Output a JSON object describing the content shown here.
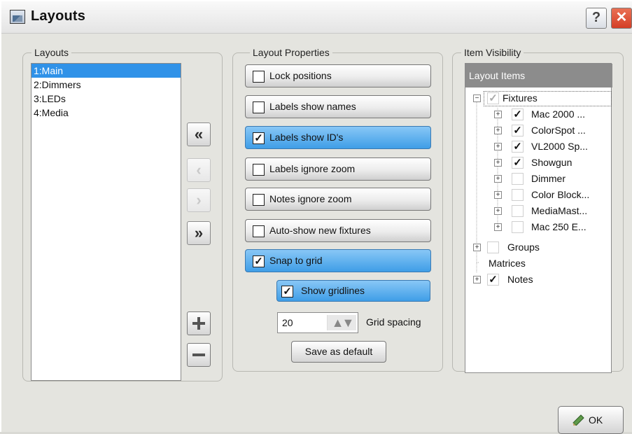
{
  "window": {
    "title": "Layouts",
    "help_label": "?",
    "close_label": "✕"
  },
  "layouts": {
    "group_label": "Layouts",
    "items": [
      "1:Main",
      "2:Dimmers",
      "3:LEDs",
      "4:Media"
    ],
    "selected_index": 0
  },
  "buttons": {
    "move_first": "«",
    "move_prev": "‹",
    "move_next": "›",
    "move_last": "»"
  },
  "properties": {
    "group_label": "Layout Properties",
    "items": [
      {
        "label": "Lock positions",
        "checked": false
      },
      {
        "label": "Labels show names",
        "checked": false
      },
      {
        "label": "Labels show ID's",
        "checked": true
      },
      {
        "label": "Labels ignore zoom",
        "checked": false
      },
      {
        "label": "Notes ignore zoom",
        "checked": false
      },
      {
        "label": "Auto-show new fixtures",
        "checked": false
      },
      {
        "label": "Snap to grid",
        "checked": true
      }
    ],
    "show_gridlines": {
      "label": "Show gridlines",
      "checked": true
    },
    "grid_spacing_value": "20",
    "grid_spacing_label": "Grid spacing",
    "save_default_label": "Save as default"
  },
  "visibility": {
    "group_label": "Item Visibility",
    "header": "Layout Items",
    "fixtures": {
      "label": "Fixtures",
      "checked": true,
      "expander": "−"
    },
    "fixture_items": [
      {
        "label": "Mac 2000 ...",
        "checked": true
      },
      {
        "label": "ColorSpot ...",
        "checked": true
      },
      {
        "label": "VL2000 Sp...",
        "checked": true
      },
      {
        "label": "Showgun",
        "checked": true
      },
      {
        "label": "Dimmer",
        "checked": false
      },
      {
        "label": "Color Block...",
        "checked": false
      },
      {
        "label": "MediaMast...",
        "checked": false
      },
      {
        "label": "Mac 250 E...",
        "checked": false
      }
    ],
    "groups": {
      "label": "Groups",
      "checked": false
    },
    "matrices": {
      "label": "Matrices"
    },
    "notes": {
      "label": "Notes",
      "checked": true
    },
    "expander_plus": "+"
  },
  "ok_label": "OK",
  "colors": {
    "selection": "#3092e8",
    "toggle_on": "#3f9ee7",
    "close": "#d43e26"
  }
}
